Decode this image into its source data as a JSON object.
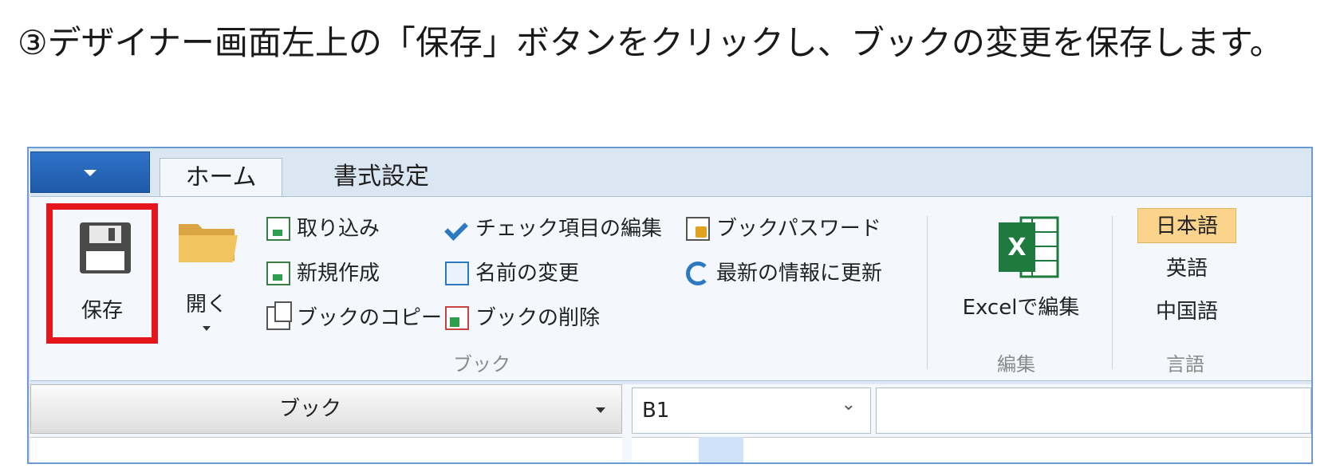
{
  "instruction": "③デザイナー画面左上の「保存」ボタンをクリックし、ブックの変更を保存します。",
  "tabs": [
    {
      "label": "ホーム",
      "active": true
    },
    {
      "label": "書式設定",
      "active": false
    }
  ],
  "ribbon": {
    "save_label": "保存",
    "open_label": "開く",
    "book_commands": [
      "取り込み",
      "新規作成",
      "ブックのコピー",
      "チェック項目の編集",
      "名前の変更",
      "ブックの削除",
      "ブックパスワード",
      "最新の情報に更新"
    ],
    "book_group_label": "ブック",
    "excel_label": "Excelで編集",
    "edit_group_label": "編集",
    "languages": [
      "日本語",
      "英語",
      "中国語"
    ],
    "language_selected": "日本語",
    "language_group_label": "言語"
  },
  "bottom": {
    "book_dropdown": "ブック",
    "cell_ref": "B1"
  },
  "colors": {
    "highlight_border": "#e3161c",
    "file_button": "#2f73c9",
    "language_selected": "#fbd38a",
    "excel_green": "#1f7a3d"
  }
}
